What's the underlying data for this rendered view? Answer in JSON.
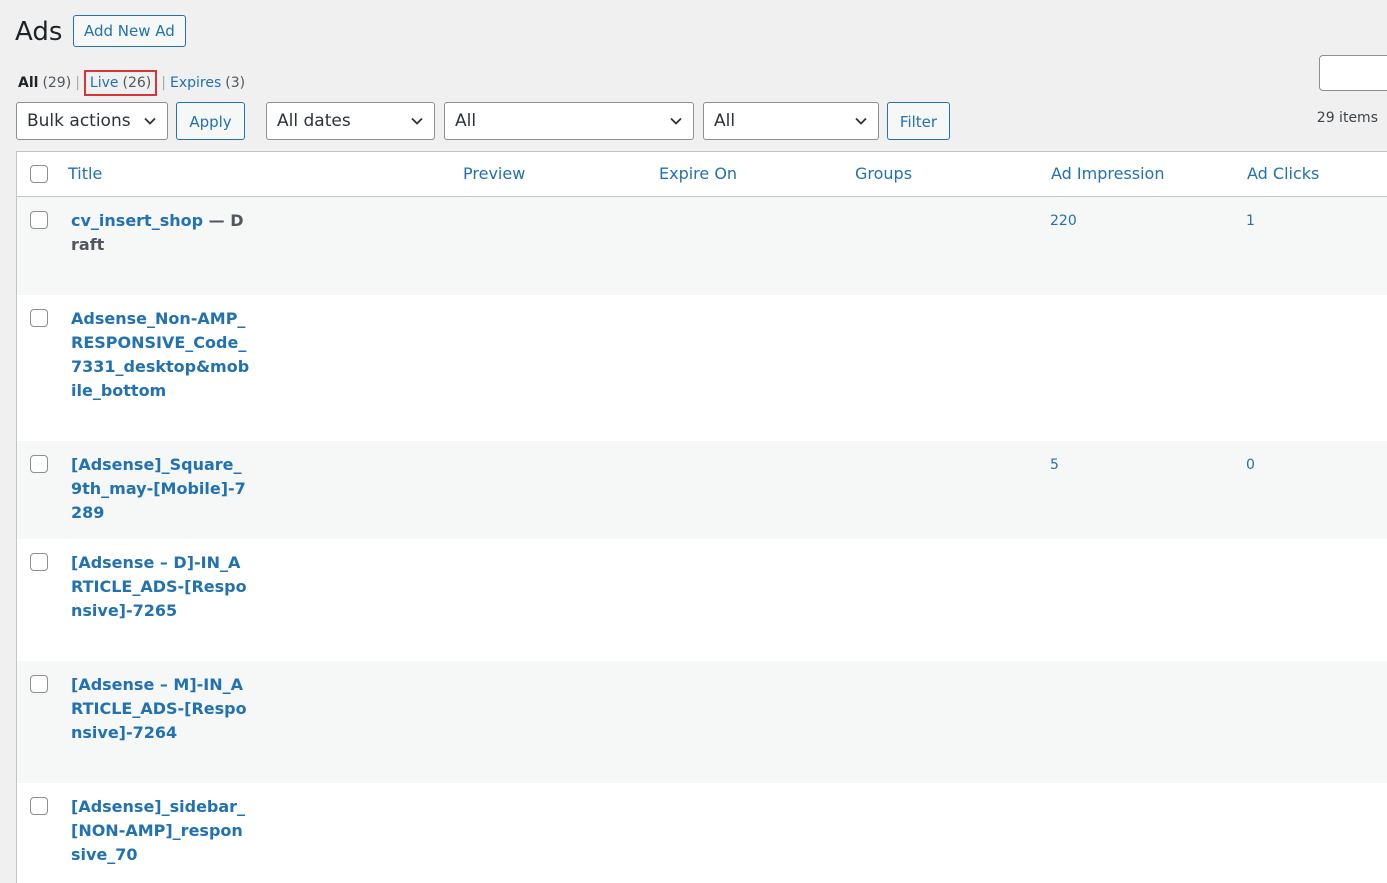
{
  "header": {
    "title": "Ads",
    "add_new_label": "Add New Ad"
  },
  "filters_nav": {
    "all_label": "All",
    "all_count": "(29)",
    "live_label": "Live",
    "live_count": "(26)",
    "expires_label": "Expires",
    "expires_count": "(3)",
    "separator": "|"
  },
  "toolbar": {
    "bulk_actions": "Bulk actions",
    "apply_label": "Apply",
    "dates": "All dates",
    "filter1": "All",
    "filter2": "All",
    "filter_label": "Filter",
    "items_count": "29 items"
  },
  "table": {
    "columns": [
      "Title",
      "Preview",
      "Expire On",
      "Groups",
      "Ad Impression",
      "Ad Clicks"
    ],
    "rows": [
      {
        "title": "cv_insert_shop",
        "state": "— Draft",
        "impressions": "220",
        "clicks": "1"
      },
      {
        "title": "Adsense_Non-AMP_RESPONSIVE_Code_7331_desktop&mobile_bottom",
        "state": "",
        "impressions": "",
        "clicks": ""
      },
      {
        "title": "[Adsense]_Square_9th_may-[Mobile]-7289",
        "state": "",
        "impressions": "5",
        "clicks": "0"
      },
      {
        "title": "[Adsense – D]-IN_ARTICLE_ADS-[Responsive]-7265",
        "state": "",
        "impressions": "",
        "clicks": ""
      },
      {
        "title": "[Adsense – M]-IN_ARTICLE_ADS-[Responsive]-7264",
        "state": "",
        "impressions": "",
        "clicks": ""
      },
      {
        "title": "[Adsense]_sidebar_[NON-AMP]_responsive_70",
        "state": "",
        "impressions": "",
        "clicks": ""
      }
    ]
  },
  "colors": {
    "accent": "#2271b1",
    "highlight_border": "#d63638"
  }
}
